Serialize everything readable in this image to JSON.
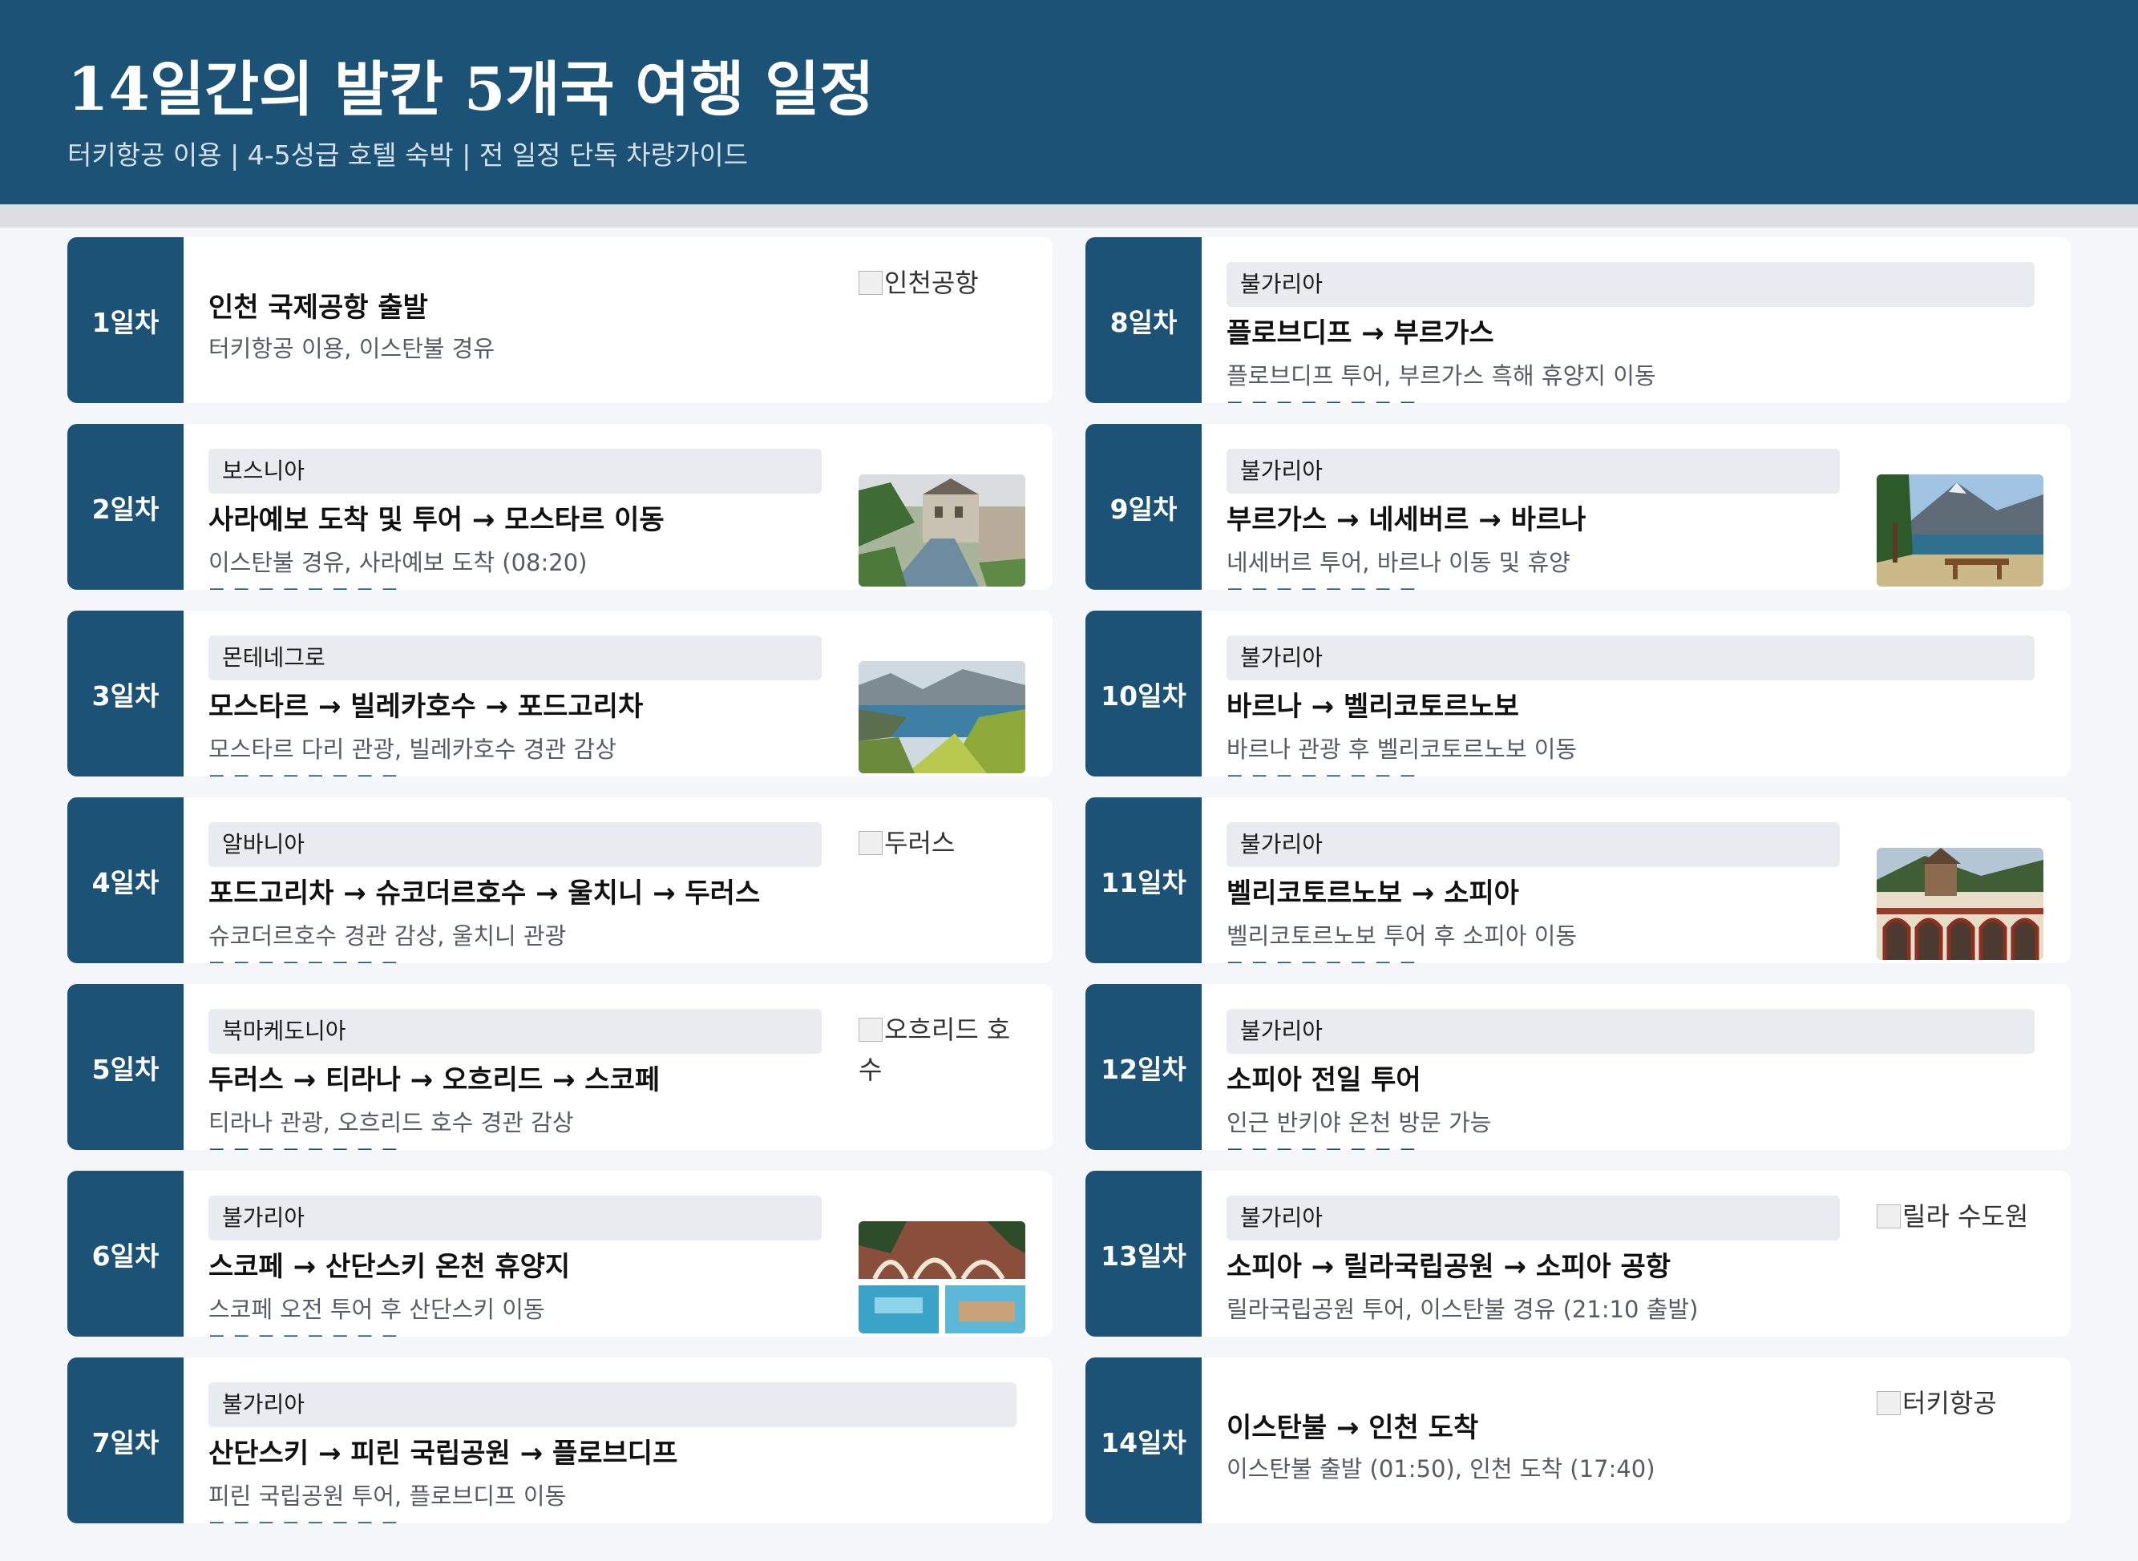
{
  "header": {
    "title": "14일간의 발칸 5개국 여행 일정",
    "subtitle": "터키항공 이용 | 4-5성급 호텔 숙박 | 전 일정 단독 차량가이드"
  },
  "days": [
    {
      "day": "1일차",
      "country": "",
      "route": "인천 국제공항 출발",
      "desc": "터키항공 이용, 이스탄불 경유",
      "image_alt": "인천공항",
      "image_state": "broken"
    },
    {
      "day": "2일차",
      "country": "보스니아",
      "route": "사라예보 도착 및 투어 → 모스타르 이동",
      "desc": "이스탄불 경유, 사라예보 도착 (08:20)",
      "image_state": "photo",
      "image_subject": "old-town-river"
    },
    {
      "day": "3일차",
      "country": "몬테네그로",
      "route": "모스타르 → 빌레카호수 → 포드고리차",
      "desc": "모스타르 다리 관광, 빌레카호수 경관 감상",
      "image_state": "photo",
      "image_subject": "bay-mountains"
    },
    {
      "day": "4일차",
      "country": "알바니아",
      "route": "포드고리차 → 슈코더르호수 → 울치니 → 두러스",
      "desc": "슈코더르호수 경관 감상, 울치니 관광",
      "image_alt": "두러스",
      "image_state": "broken"
    },
    {
      "day": "5일차",
      "country": "북마케도니아",
      "route": "두러스 → 티라나 → 오흐리드 → 스코페",
      "desc": "티라나 관광, 오흐리드 호수 경관 감상",
      "image_alt": "오흐리드 호수",
      "image_state": "broken"
    },
    {
      "day": "6일차",
      "country": "불가리아",
      "route": "스코페 → 산단스키 온천 휴양지",
      "desc": "스코페 오전 투어 후 산단스키 이동",
      "image_state": "photo",
      "image_subject": "monastery-pool-collage"
    },
    {
      "day": "7일차",
      "country": "불가리아",
      "route": "산단스키 → 피린 국립공원 → 플로브디프",
      "desc": "피린 국립공원 투어, 플로브디프 이동",
      "image_state": "none"
    },
    {
      "day": "8일차",
      "country": "불가리아",
      "route": "플로브디프 → 부르가스",
      "desc": "플로브디프 투어, 부르가스 흑해 휴양지 이동",
      "image_state": "none"
    },
    {
      "day": "9일차",
      "country": "불가리아",
      "route": "부르가스 → 네세버르 → 바르나",
      "desc": "네세버르 투어, 바르나 이동 및 휴양",
      "image_state": "photo",
      "image_subject": "lake-bench"
    },
    {
      "day": "10일차",
      "country": "불가리아",
      "route": "바르나 → 벨리코토르노보",
      "desc": "바르나 관광 후 벨리코토르노보 이동",
      "image_state": "none"
    },
    {
      "day": "11일차",
      "country": "불가리아",
      "route": "벨리코토르노보 → 소피아",
      "desc": "벨리코토르노보 투어 후 소피아 이동",
      "image_state": "photo",
      "image_subject": "rila-monastery"
    },
    {
      "day": "12일차",
      "country": "불가리아",
      "route": "소피아 전일 투어",
      "desc": "인근 반키야 온천 방문 가능",
      "image_state": "none"
    },
    {
      "day": "13일차",
      "country": "불가리아",
      "route": "소피아 → 릴라국립공원 → 소피아 공항",
      "desc": "릴라국립공원 투어, 이스탄불 경유 (21:10 출발)",
      "image_alt": "릴라 수도원",
      "image_state": "broken"
    },
    {
      "day": "14일차",
      "country": "",
      "route": "이스탄불 → 인천 도착",
      "desc": "이스탄불 출발 (01:50), 인천 도착 (17:40)",
      "image_alt": "터키항공",
      "image_state": "broken"
    }
  ],
  "colors": {
    "primary": "#1c5275",
    "country_tag_bg": "#e8ecf0",
    "page_bg": "#f4f6f9",
    "card_bg": "#ffffff",
    "desc_text": "#555c63"
  },
  "icons": {
    "broken_image": "broken-image-icon"
  }
}
